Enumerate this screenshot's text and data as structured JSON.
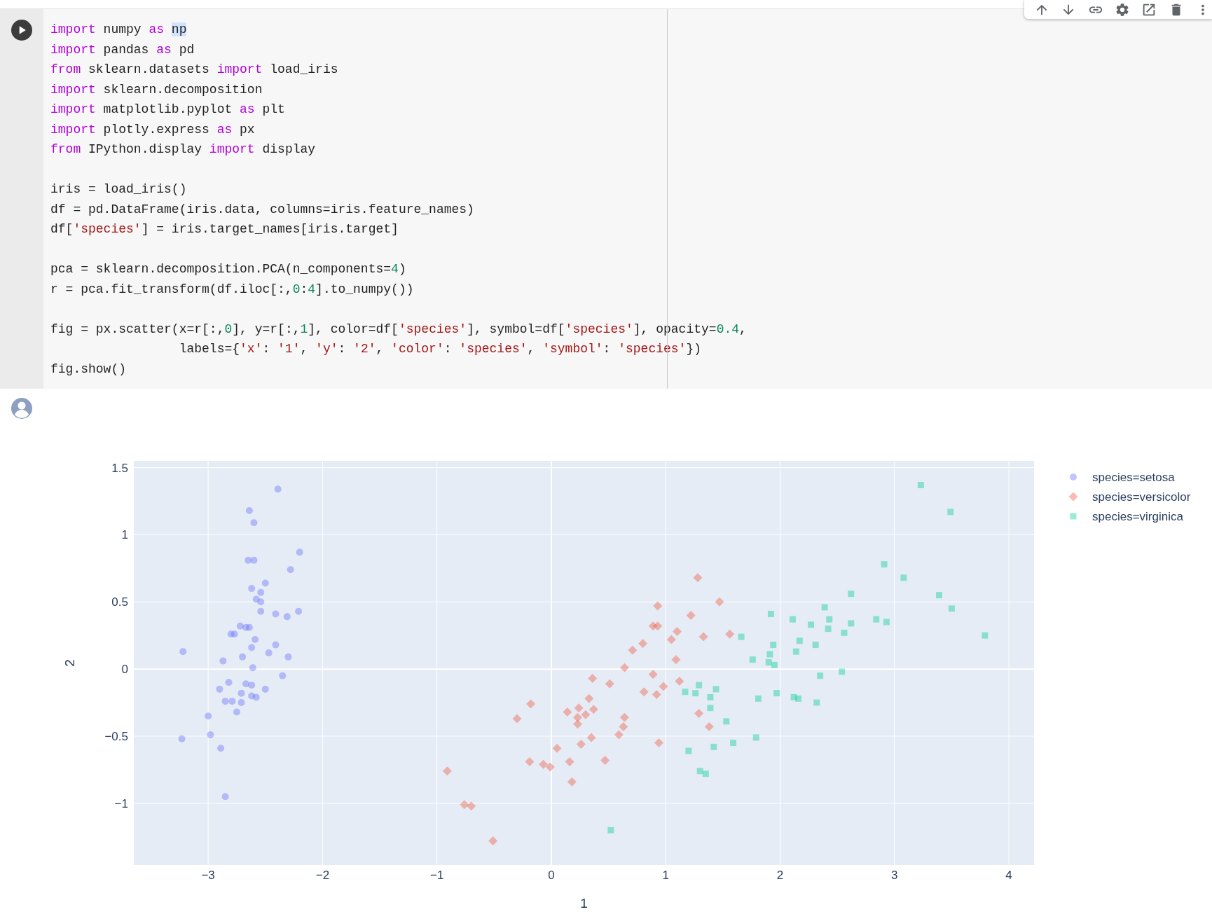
{
  "code_cell": {
    "blocks": [
      [
        [
          {
            "text": "import",
            "kind": "kw"
          },
          {
            "text": " numpy ",
            "kind": "plain"
          },
          {
            "text": "as ",
            "kind": "kw"
          },
          {
            "text": "np",
            "kind": "sel"
          }
        ],
        [
          {
            "text": "import",
            "kind": "kw"
          },
          {
            "text": " pandas ",
            "kind": "plain"
          },
          {
            "text": "as",
            "kind": "kw"
          },
          {
            "text": " pd",
            "kind": "plain"
          }
        ],
        [
          {
            "text": "from",
            "kind": "kw"
          },
          {
            "text": " sklearn.datasets ",
            "kind": "plain"
          },
          {
            "text": "import",
            "kind": "kw"
          },
          {
            "text": " load_iris",
            "kind": "plain"
          }
        ],
        [
          {
            "text": "import",
            "kind": "kw"
          },
          {
            "text": " sklearn.decomposition",
            "kind": "plain"
          }
        ],
        [
          {
            "text": "import",
            "kind": "kw"
          },
          {
            "text": " matplotlib.pyplot ",
            "kind": "plain"
          },
          {
            "text": "as",
            "kind": "kw"
          },
          {
            "text": " plt",
            "kind": "plain"
          }
        ],
        [
          {
            "text": "import",
            "kind": "kw"
          },
          {
            "text": " plotly.express ",
            "kind": "plain"
          },
          {
            "text": "as",
            "kind": "kw"
          },
          {
            "text": " px",
            "kind": "plain"
          }
        ],
        [
          {
            "text": "from",
            "kind": "kw"
          },
          {
            "text": " IPython.display ",
            "kind": "plain"
          },
          {
            "text": "import",
            "kind": "kw"
          },
          {
            "text": " display",
            "kind": "plain"
          }
        ]
      ],
      [
        [
          {
            "text": "iris = load_iris()",
            "kind": "plain"
          }
        ],
        [
          {
            "text": "df = pd.DataFrame(iris.data, columns=iris.feature_names)",
            "kind": "plain"
          }
        ],
        [
          {
            "text": "df[",
            "kind": "plain"
          },
          {
            "text": "'species'",
            "kind": "str"
          },
          {
            "text": "] = iris.target_names[iris.target]",
            "kind": "plain"
          }
        ]
      ],
      [
        [
          {
            "text": "pca = sklearn.decomposition.PCA(n_components=",
            "kind": "plain"
          },
          {
            "text": "4",
            "kind": "num"
          },
          {
            "text": ")",
            "kind": "plain"
          }
        ],
        [
          {
            "text": "r = pca.fit_transform(df.iloc[:,",
            "kind": "plain"
          },
          {
            "text": "0",
            "kind": "num"
          },
          {
            "text": ":",
            "kind": "plain"
          },
          {
            "text": "4",
            "kind": "num"
          },
          {
            "text": "].to_numpy())",
            "kind": "plain"
          }
        ]
      ],
      [
        [
          {
            "text": "fig = px.scatter(x=r[:,",
            "kind": "plain"
          },
          {
            "text": "0",
            "kind": "num"
          },
          {
            "text": "], y=r[:,",
            "kind": "plain"
          },
          {
            "text": "1",
            "kind": "num"
          },
          {
            "text": "], color=df[",
            "kind": "plain"
          },
          {
            "text": "'species'",
            "kind": "str"
          },
          {
            "text": "], symbol=df[",
            "kind": "plain"
          },
          {
            "text": "'species'",
            "kind": "str"
          },
          {
            "text": "], opacity=",
            "kind": "plain"
          },
          {
            "text": "0.4",
            "kind": "num"
          },
          {
            "text": ",",
            "kind": "plain"
          }
        ],
        [
          {
            "text": "                 labels={",
            "kind": "plain"
          },
          {
            "text": "'x'",
            "kind": "str"
          },
          {
            "text": ": ",
            "kind": "plain"
          },
          {
            "text": "'1'",
            "kind": "str"
          },
          {
            "text": ", ",
            "kind": "plain"
          },
          {
            "text": "'y'",
            "kind": "str"
          },
          {
            "text": ": ",
            "kind": "plain"
          },
          {
            "text": "'2'",
            "kind": "str"
          },
          {
            "text": ", ",
            "kind": "plain"
          },
          {
            "text": "'color'",
            "kind": "str"
          },
          {
            "text": ": ",
            "kind": "plain"
          },
          {
            "text": "'species'",
            "kind": "str"
          },
          {
            "text": ", ",
            "kind": "plain"
          },
          {
            "text": "'symbol'",
            "kind": "str"
          },
          {
            "text": ": ",
            "kind": "plain"
          },
          {
            "text": "'species'",
            "kind": "str"
          },
          {
            "text": "})",
            "kind": "plain"
          }
        ],
        [
          {
            "text": "fig.show()",
            "kind": "plain"
          }
        ]
      ]
    ]
  },
  "output": {
    "chart_data": {
      "type": "scatter",
      "xlabel": "1",
      "ylabel": "2",
      "xlim": [
        -3.65,
        4.22
      ],
      "ylim": [
        -1.46,
        1.55
      ],
      "grid": true,
      "legend": true,
      "xticks": [
        {
          "value": -3,
          "label": "−3"
        },
        {
          "value": -2,
          "label": "−2"
        },
        {
          "value": -1,
          "label": "−1"
        },
        {
          "value": 0,
          "label": "0"
        },
        {
          "value": 1,
          "label": "1"
        },
        {
          "value": 2,
          "label": "2"
        },
        {
          "value": 3,
          "label": "3"
        },
        {
          "value": 4,
          "label": "4"
        }
      ],
      "yticks": [
        {
          "value": -1,
          "label": "−1"
        },
        {
          "value": -0.5,
          "label": "−0.5"
        },
        {
          "value": 0,
          "label": "0"
        },
        {
          "value": 0.5,
          "label": "0.5"
        },
        {
          "value": 1,
          "label": "1"
        },
        {
          "value": 1.5,
          "label": "1.5"
        }
      ],
      "series": [
        {
          "name": "species=setosa",
          "color": "#636efa",
          "x": [
            -2.39,
            -2.64,
            -2.6,
            -2.65,
            -2.6,
            -2.2,
            -2.28,
            -2.5,
            -2.62,
            -2.54,
            -2.58,
            -2.54,
            -2.54,
            -2.41,
            -2.31,
            -2.21,
            -2.72,
            -2.67,
            -2.64,
            -2.8,
            -2.77,
            -2.59,
            -2.41,
            -2.62,
            -2.47,
            -3.22,
            -2.7,
            -2.3,
            -2.87,
            -2.61,
            -2.35,
            -2.82,
            -2.67,
            -2.62,
            -2.5,
            -2.9,
            -2.71,
            -2.62,
            -2.58,
            -2.85,
            -2.79,
            -2.71,
            -2.75,
            -3.0,
            -2.98,
            -3.23,
            -2.89,
            -2.85
          ],
          "values": [
            1.34,
            1.18,
            1.09,
            0.81,
            0.81,
            0.87,
            0.74,
            0.64,
            0.6,
            0.57,
            0.52,
            0.5,
            0.43,
            0.41,
            0.39,
            0.43,
            0.32,
            0.31,
            0.31,
            0.26,
            0.26,
            0.22,
            0.18,
            0.16,
            0.12,
            0.13,
            0.09,
            0.09,
            0.06,
            0.01,
            -0.05,
            -0.1,
            -0.11,
            -0.12,
            -0.15,
            -0.15,
            -0.18,
            -0.2,
            -0.21,
            -0.24,
            -0.24,
            -0.25,
            -0.32,
            -0.35,
            -0.49,
            -0.52,
            -0.59,
            -0.95
          ]
        },
        {
          "name": "species=versicolor",
          "color": "#ef553b",
          "x": [
            1.28,
            1.47,
            0.93,
            1.22,
            0.89,
            0.93,
            1.1,
            1.05,
            1.33,
            1.56,
            0.8,
            0.71,
            1.09,
            0.64,
            0.89,
            1.12,
            0.36,
            0.51,
            0.98,
            0.81,
            0.92,
            0.33,
            -0.18,
            0.24,
            0.37,
            0.14,
            0.3,
            0.23,
            1.29,
            -0.3,
            0.64,
            0.23,
            1.38,
            0.63,
            0.35,
            0.59,
            0.94,
            0.26,
            0.05,
            -0.19,
            0.16,
            -0.07,
            -0.01,
            0.47,
            0.18,
            -0.91,
            -0.76,
            -0.7,
            -0.51
          ],
          "values": [
            0.68,
            0.5,
            0.47,
            0.4,
            0.32,
            0.32,
            0.28,
            0.22,
            0.24,
            0.26,
            0.19,
            0.14,
            0.07,
            0.01,
            -0.04,
            -0.09,
            -0.07,
            -0.11,
            -0.13,
            -0.17,
            -0.19,
            -0.22,
            -0.26,
            -0.29,
            -0.3,
            -0.32,
            -0.34,
            -0.36,
            -0.33,
            -0.37,
            -0.36,
            -0.41,
            -0.43,
            -0.43,
            -0.51,
            -0.49,
            -0.55,
            -0.56,
            -0.59,
            -0.69,
            -0.69,
            -0.71,
            -0.73,
            -0.68,
            -0.84,
            -0.76,
            -1.01,
            -1.02,
            -1.28
          ]
        },
        {
          "name": "species=virginica",
          "color": "#00cc96",
          "x": [
            3.23,
            3.49,
            2.91,
            3.08,
            3.39,
            3.5,
            3.79,
            2.62,
            2.39,
            1.92,
            2.11,
            2.43,
            2.27,
            2.84,
            2.93,
            2.62,
            2.42,
            2.56,
            2.17,
            2.31,
            1.94,
            2.14,
            1.66,
            1.76,
            1.91,
            1.9,
            1.95,
            2.35,
            2.54,
            1.29,
            1.17,
            1.26,
            1.44,
            1.39,
            1.39,
            1.97,
            2.12,
            2.16,
            2.32,
            1.81,
            1.53,
            1.79,
            1.59,
            1.42,
            1.2,
            1.3,
            1.35,
            0.52
          ],
          "values": [
            1.37,
            1.17,
            0.78,
            0.68,
            0.55,
            0.45,
            0.25,
            0.56,
            0.46,
            0.41,
            0.37,
            0.37,
            0.33,
            0.37,
            0.35,
            0.34,
            0.3,
            0.27,
            0.21,
            0.18,
            0.18,
            0.13,
            0.24,
            0.07,
            0.11,
            0.05,
            0.03,
            -0.05,
            -0.02,
            -0.12,
            -0.17,
            -0.18,
            -0.15,
            -0.21,
            -0.29,
            -0.18,
            -0.21,
            -0.22,
            -0.25,
            -0.22,
            -0.39,
            -0.51,
            -0.55,
            -0.58,
            -0.61,
            -0.76,
            -0.78,
            -1.2
          ]
        }
      ]
    }
  }
}
